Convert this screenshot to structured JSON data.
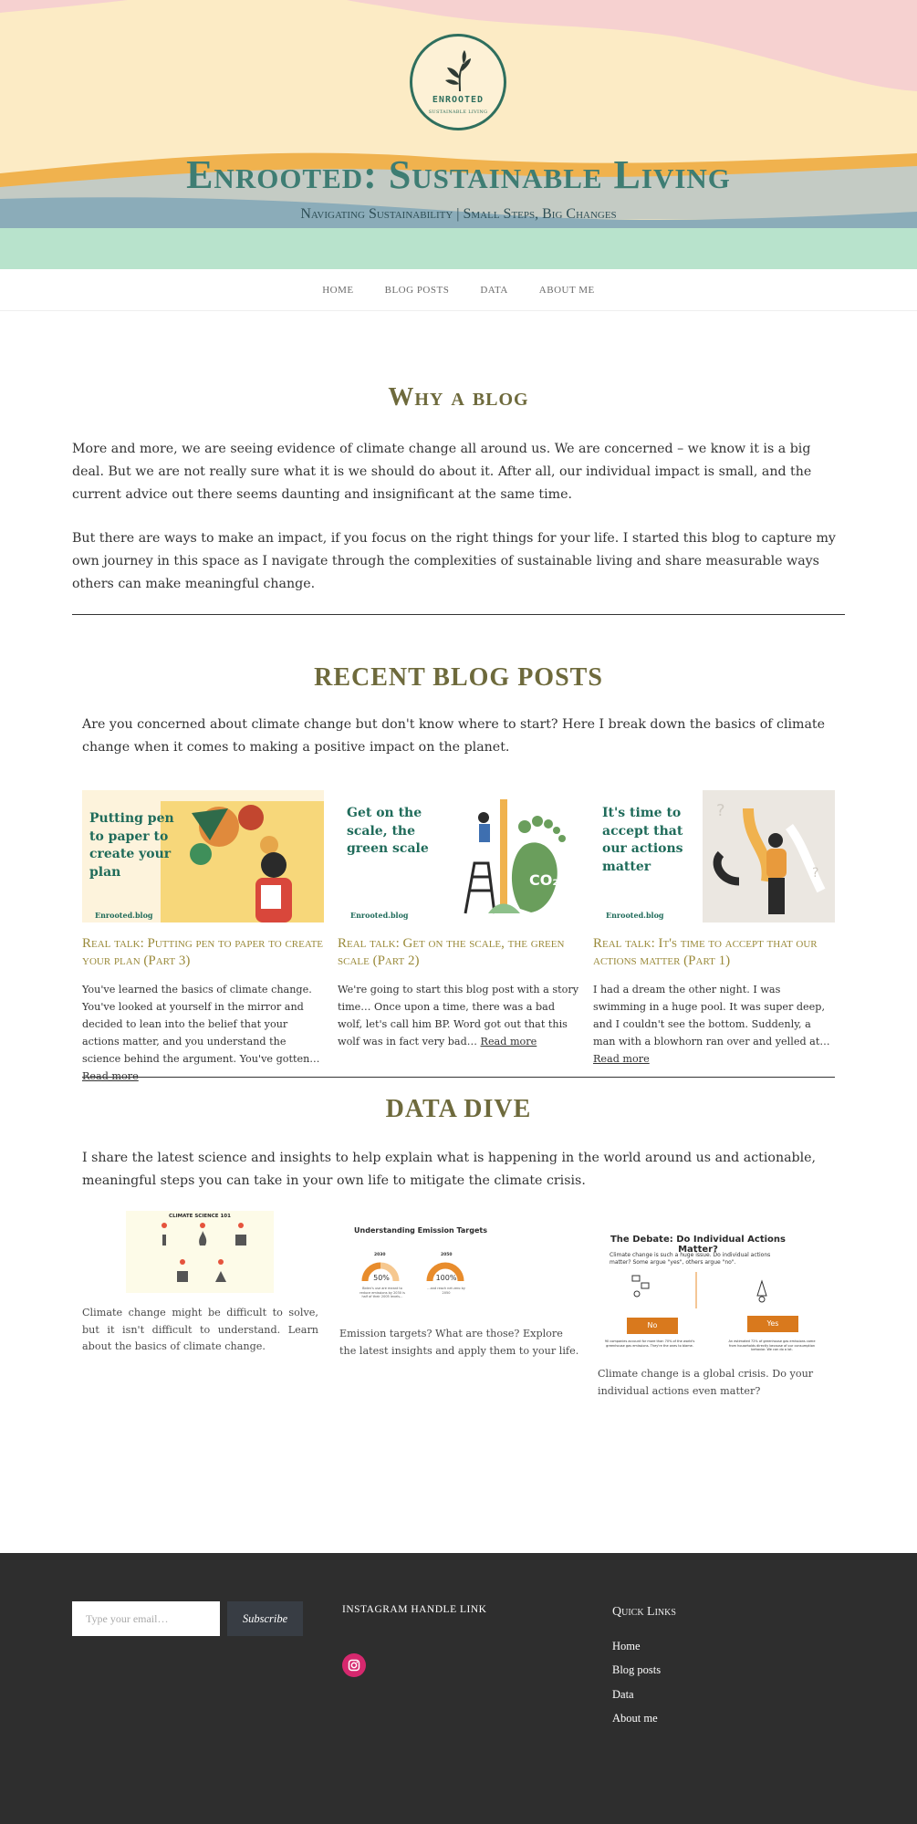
{
  "header": {
    "logo_name": "ENROOTED",
    "logo_sub": "SUSTAINABLE LIVING",
    "title": "Enrooted: Sustainable Living",
    "tagline": "Navigating Sustainability | Small Steps, Big Changes",
    "colors": {
      "pink": "#f6d1d0",
      "cream": "#fcebc5",
      "orange": "#f0b24e",
      "grey": "#c4cbc4",
      "blue": "#8bacb9",
      "mint": "#b8e3cc",
      "logo_green": "#2f6f5e"
    }
  },
  "nav": {
    "items": [
      "HOME",
      "BLOG POSTS",
      "DATA",
      "ABOUT ME"
    ]
  },
  "why": {
    "title": "Why a blog",
    "p1": "More and more, we are seeing evidence of climate change all around us. We are concerned – we know it is a big deal. But we are not really sure what it is we should do about it. After all, our individual impact is small, and the current advice out there seems daunting and insignificant at the same time.",
    "p2": "But there are ways to make an impact, if you focus on the right things for your life. I started this blog to capture my own journey in this space as I navigate through the complexities of sustainable living and share measurable ways others can make meaningful change."
  },
  "recent": {
    "title": "RECENT BLOG POSTS",
    "intro": "Are you concerned about climate change but don't know where to start? Here I break down the basics of climate change when it comes to making a positive impact on the planet.",
    "posts": [
      {
        "thumb_text": "Putting pen to paper to create your plan",
        "thumb_site": "Enrooted.blog",
        "title": "Real talk: Putting pen to paper to create your plan (Part 3)",
        "excerpt": "You've learned the basics of climate change. You've looked at yourself in the mirror and decided to lean into the belief that your actions matter, and you understand the science behind the argument. You've gotten…",
        "read_more": "Read more"
      },
      {
        "thumb_text": "Get on the scale, the green scale",
        "thumb_site": "Enrooted.blog",
        "title": "Real talk: Get on the scale, the green scale (Part 2)",
        "excerpt": "We're going to start this blog post with a story time… Once upon a time, there was a bad wolf, let's call him BP. Word got out that this wolf was in fact very bad…",
        "read_more": "Read more"
      },
      {
        "thumb_text": "It's time to accept that our actions matter",
        "thumb_site": "Enrooted.blog",
        "title": "Real talk: It's time to accept that our actions matter (Part 1)",
        "excerpt": "I had a dream the other night. I was swimming in a huge pool. It was super deep, and I couldn't see the bottom. Suddenly, a man with a blowhorn ran over and yelled at…",
        "read_more": "Read more"
      }
    ]
  },
  "data_dive": {
    "title": "DATA DIVE",
    "intro": "I share the latest science and insights to help explain what is happening in the world around us and actionable, meaningful steps you can take in your own life to mitigate the climate crisis.",
    "cards": [
      {
        "img_title": "CLIMATE SCIENCE 101",
        "text": "Climate change might be difficult to solve, but it isn't difficult to understand. Learn about the basics of climate change."
      },
      {
        "img_title": "Understanding Emission Targets",
        "gauge1_year": "2030",
        "gauge1_value": "50%",
        "gauge1_note": "Biden's use are meant to reduce emissions by 2030 is half of their 2005 levels…",
        "gauge2_year": "2050",
        "gauge2_value": "100%",
        "gauge2_note": "…and reach net zero by 2050",
        "text": "Emission targets? What are those? Explore the latest insights and apply them to your life."
      },
      {
        "img_title": "The Debate: Do Individual Actions Matter?",
        "img_sub": "Climate change is such a huge issue. Do individual actions matter? Some argue \"yes\", others argue \"no\".",
        "no_label": "No",
        "yes_label": "Yes",
        "no_note": "90 companies account for more than 70% of the world's greenhouse gas emissions. They're the ones to blame.",
        "yes_note": "An estimated 72% of greenhouse gas emissions come from households directly because of our consumption behavior. We can do a lot.",
        "text": "Climate change is a global crisis. Do your individual actions even matter?"
      }
    ]
  },
  "footer": {
    "email_placeholder": "Type your email…",
    "subscribe": "Subscribe",
    "instagram_heading": "INSTAGRAM HANDLE LINK",
    "quick_links_heading": "Quick Links",
    "links": [
      "Home",
      "Blog posts",
      "Data",
      "About me"
    ],
    "bg_color": "#2e2e2e",
    "instagram_color": "#d6286e"
  }
}
